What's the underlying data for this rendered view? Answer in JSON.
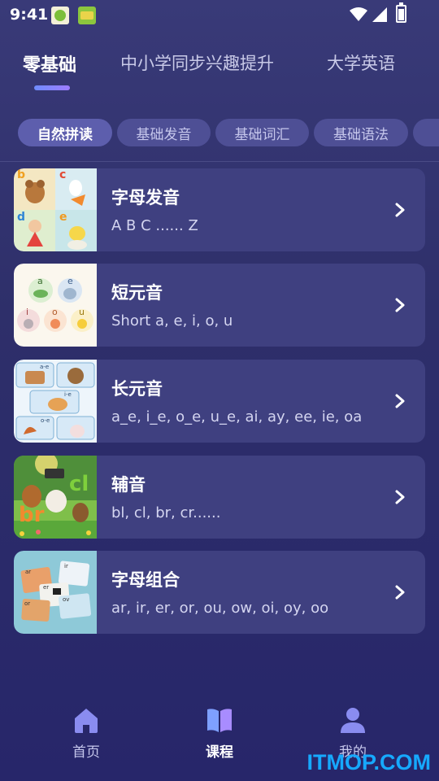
{
  "status_bar": {
    "time": "9:41"
  },
  "top_tabs": [
    {
      "label": "零基础",
      "active": true
    },
    {
      "label": "中小学同步兴趣提升",
      "active": false
    },
    {
      "label": "大学英语",
      "active": false
    }
  ],
  "sub_tabs": [
    {
      "label": "自然拼读",
      "active": true
    },
    {
      "label": "基础发音",
      "active": false
    },
    {
      "label": "基础词汇",
      "active": false
    },
    {
      "label": "基础语法",
      "active": false
    }
  ],
  "courses": [
    {
      "title": "字母发音",
      "subtitle": "A B C ...... Z",
      "thumb_letters": [
        "b",
        "c",
        "d",
        "e"
      ]
    },
    {
      "title": "短元音",
      "subtitle": "Short a, e, i, o, u",
      "thumb_letters": [
        "a",
        "e",
        "i",
        "o",
        "u"
      ]
    },
    {
      "title": "长元音",
      "subtitle": "a_e, i_e, o_e, u_e, ai, ay, ee, ie, oa",
      "thumb_letters": [
        "a-e",
        "i-e",
        "o-e"
      ]
    },
    {
      "title": "辅音",
      "subtitle": "bl, cl, br, cr......",
      "thumb_letters": [
        "cl",
        "br"
      ]
    },
    {
      "title": "字母组合",
      "subtitle": "ar, ir, er, or, ou, ow, oi, oy, oo",
      "thumb_letters": [
        "ar",
        "ir",
        "er",
        "or",
        "ov"
      ]
    }
  ],
  "bottom_nav": [
    {
      "label": "首页",
      "icon": "home-icon",
      "active": false
    },
    {
      "label": "课程",
      "icon": "book-icon",
      "active": true
    },
    {
      "label": "我的",
      "icon": "user-icon",
      "active": false
    }
  ],
  "watermark": "ITMOP.COM",
  "colors": {
    "accent": "#6f8cff",
    "card": "#3f4080",
    "chip": "#4e4f95",
    "background": "#2e2f6a"
  }
}
